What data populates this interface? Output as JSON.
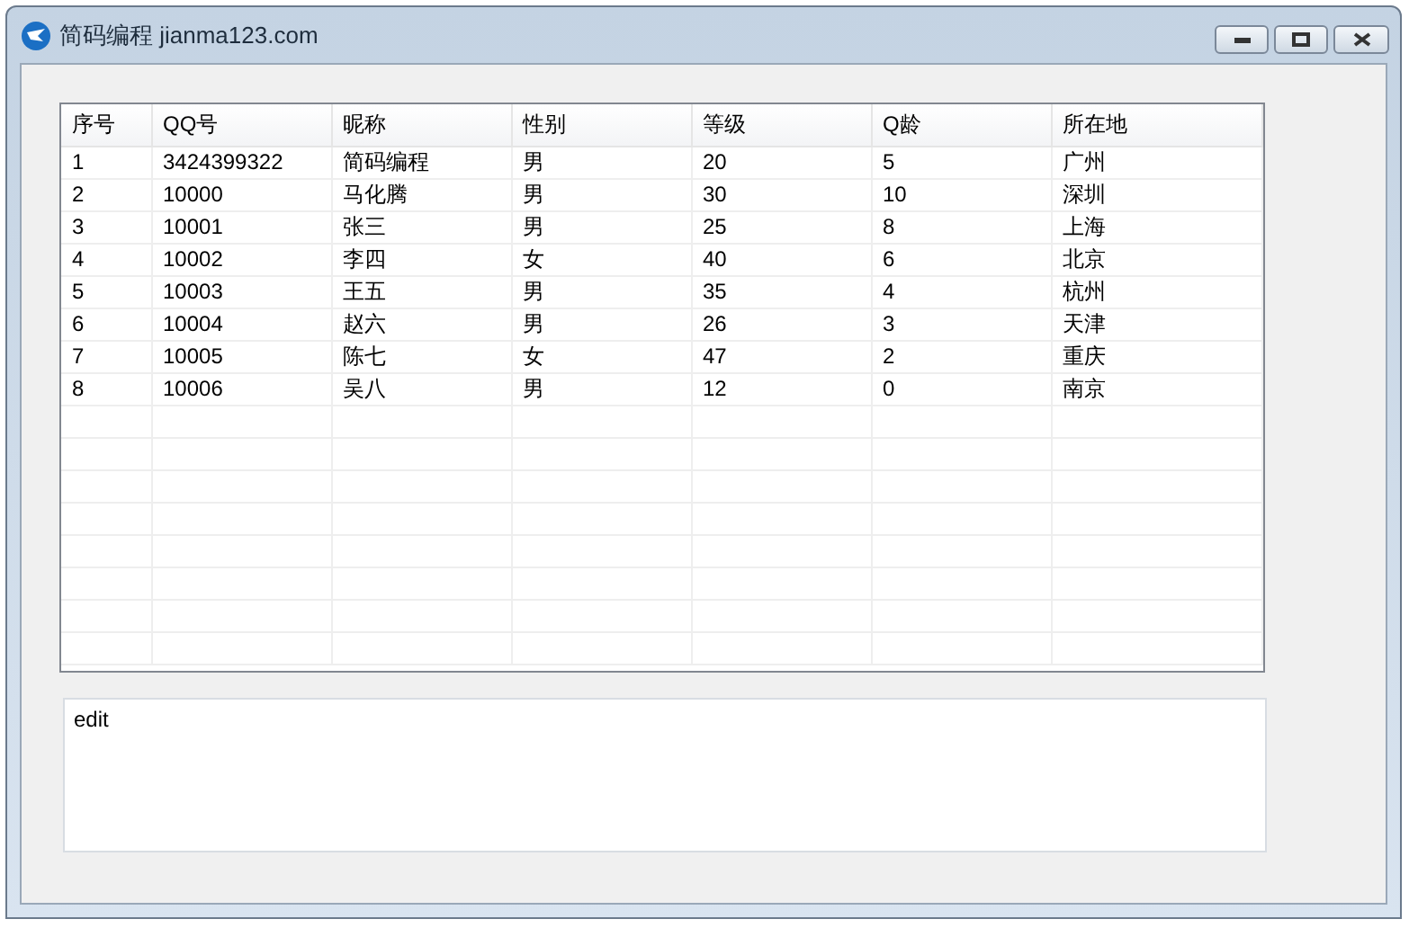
{
  "window": {
    "title": "简码编程 jianma123.com"
  },
  "table": {
    "columns": [
      "序号",
      "QQ号",
      "昵称",
      "性别",
      "等级",
      "Q龄",
      "所在地"
    ],
    "rows": [
      [
        "1",
        "3424399322",
        "简码编程",
        "男",
        "20",
        "5",
        "广州"
      ],
      [
        "2",
        "10000",
        "马化腾",
        "男",
        "30",
        "10",
        "深圳"
      ],
      [
        "3",
        "10001",
        "张三",
        "男",
        "25",
        "8",
        "上海"
      ],
      [
        "4",
        "10002",
        "李四",
        "女",
        "40",
        "6",
        "北京"
      ],
      [
        "5",
        "10003",
        "王五",
        "男",
        "35",
        "4",
        "杭州"
      ],
      [
        "6",
        "10004",
        "赵六",
        "男",
        "26",
        "3",
        "天津"
      ],
      [
        "7",
        "10005",
        "陈七",
        "女",
        "47",
        "2",
        "重庆"
      ],
      [
        "8",
        "10006",
        "吴八",
        "男",
        "12",
        "0",
        "南京"
      ]
    ]
  },
  "edit": {
    "value": "edit"
  }
}
